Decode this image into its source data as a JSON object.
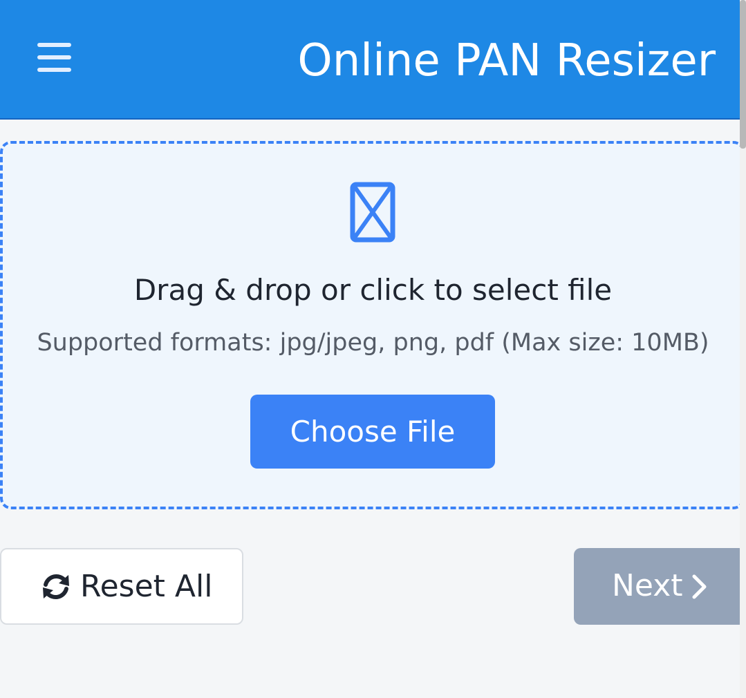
{
  "header": {
    "title": "Online PAN Resizer",
    "menu_icon": "hamburger-menu-icon",
    "background_color": "#1e88e5"
  },
  "dropzone": {
    "icon": "file-icon",
    "prompt": "Drag & drop or click to select file",
    "formats": "Supported formats: jpg/jpeg, png, pdf (Max size: 10MB)",
    "choose_button": "Choose File",
    "border_color": "#3b82f6"
  },
  "actions": {
    "reset_icon": "refresh-icon",
    "reset_label": "Reset All",
    "next_label": "Next",
    "next_icon": "chevron-right-icon",
    "next_color": "#94a3b8"
  }
}
